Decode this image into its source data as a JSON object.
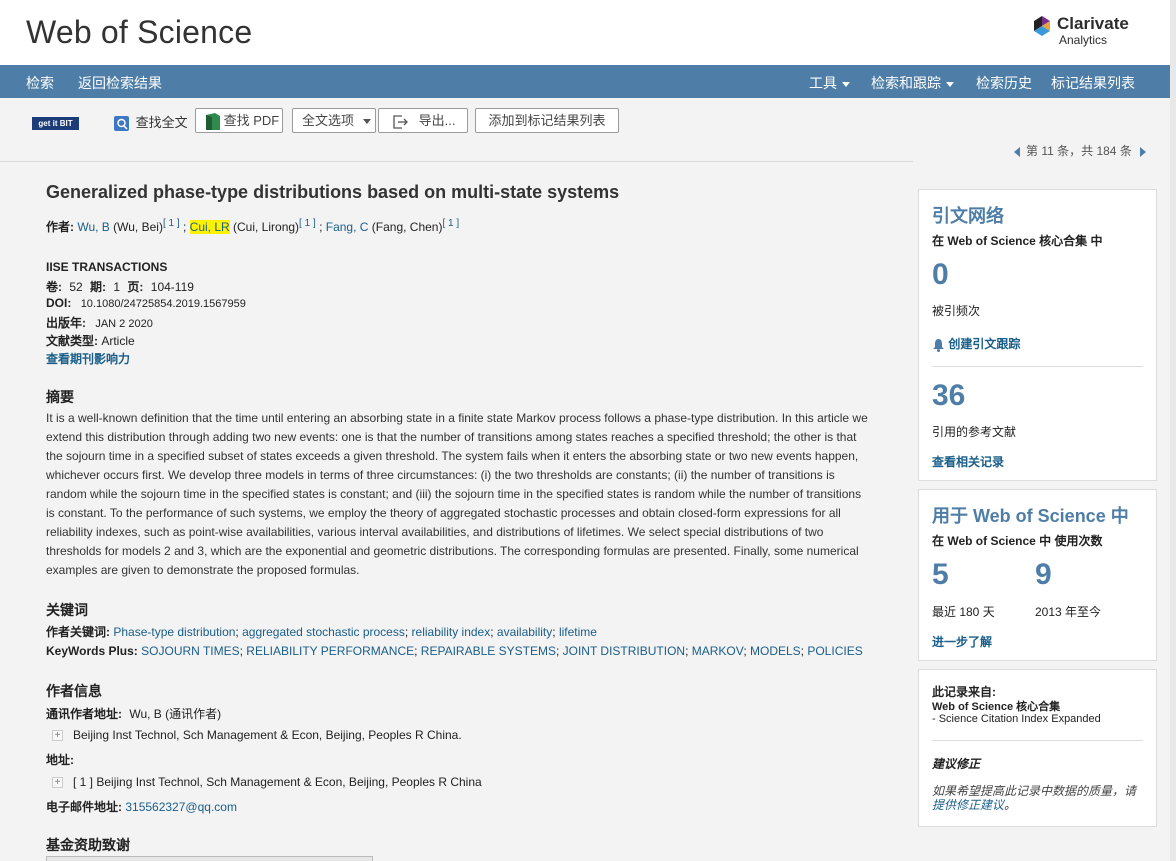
{
  "header": {
    "brand": "Web of Science",
    "vendor_line1": "Clarivate",
    "vendor_line2": "Analytics"
  },
  "nav": {
    "search": "检索",
    "back": "返回检索结果",
    "tools": "工具",
    "search_track": "检索和跟踪",
    "history": "检索历史",
    "marked_list": "标记结果列表"
  },
  "toolbar": {
    "getit": "get it BIT",
    "fulltext": "查找全文",
    "find_pdf": "查找 PDF",
    "fulltext_options": "全文选项",
    "export": "导出...",
    "add_marked": "添加到标记结果列表"
  },
  "pager": {
    "text": "第 11 条，共 184 条"
  },
  "record": {
    "title": "Generalized phase-type distributions based on multi-state systems",
    "authors_label": "作者:",
    "author1": "Wu, B",
    "author1_full": "(Wu, Bei)",
    "author2": "Cui, LR",
    "author2_full": "(Cui, Lirong)",
    "author3": "Fang, C",
    "author3_full": "(Fang, Chen)",
    "affil_ref": "[ 1 ]",
    "journal": "IISE TRANSACTIONS",
    "volume_label": "卷:",
    "volume": "52",
    "issue_label": "期:",
    "issue": "1",
    "pages_label": "页:",
    "pages": "104-119",
    "doi_label": "DOI:",
    "doi": "10.1080/24725854.2019.1567959",
    "pubdate_label": "出版年:",
    "pubdate": "JAN 2 2020",
    "doctype_label": "文献类型:",
    "doctype": "Article",
    "journal_impact": "查看期刊影响力",
    "abstract_heading": "摘要",
    "abstract": "It is a well-known definition that the time until entering an absorbing state in a finite state Markov process follows a phase-type distribution. In this article we extend this distribution through adding two new events: one is that the number of transitions among states reaches a specified threshold; the other is that the sojourn time in a specified subset of states exceeds a given threshold. The system fails when it enters the absorbing state or two new events happen, whichever occurs first. We develop three models in terms of three circumstances: (i) the two thresholds are constants; (ii) the number of transitions is random while the sojourn time in the specified states is constant; and (iii) the sojourn time in the specified states is random while the number of transitions is constant. To the performance of such systems, we employ the theory of aggregated stochastic processes and obtain closed-form expressions for all reliability indexes, such as point-wise availabilities, various interval availabilities, and distributions of lifetimes. We select special distributions of two thresholds for models 2 and 3, which are the exponential and geometric distributions. The corresponding formulas are presented. Finally, some numerical examples are given to demonstrate the proposed formulas.",
    "keywords_heading": "关键词",
    "author_kw_label": "作者关键词:",
    "author_keywords": [
      "Phase-type distribution",
      "aggregated stochastic process",
      "reliability index",
      "availability",
      "lifetime"
    ],
    "kwplus_label": "KeyWords Plus:",
    "keywords_plus": [
      "SOJOURN TIMES",
      "RELIABILITY PERFORMANCE",
      "REPAIRABLE SYSTEMS",
      "JOINT DISTRIBUTION",
      "MARKOV",
      "MODELS",
      "POLICIES"
    ],
    "author_info_heading": "作者信息",
    "corr_label": "通讯作者地址:",
    "corr_author": "Wu, B (通讯作者)",
    "corr_address": "Beijing Inst Technol, Sch Management & Econ, Beijing, Peoples R China.",
    "address_label": "地址:",
    "address": "[ 1 ] Beijing Inst Technol, Sch Management & Econ, Beijing, Peoples R China",
    "email_label": "电子邮件地址:",
    "email": "315562327@qq.com",
    "funding_heading": "基金资助致谢"
  },
  "citation_network": {
    "heading": "引文网络",
    "core_label": "在 Web of Science 核心合集 中",
    "times_cited": "0",
    "times_cited_label": "被引频次",
    "create_alert": "创建引文跟踪",
    "refs_count": "36",
    "refs_label": "引用的参考文献",
    "related": "查看相关记录"
  },
  "usage": {
    "heading": "用于 Web of Science 中",
    "sub": "在 Web of Science 中 使用次数",
    "last180": "5",
    "last180_label": "最近 180 天",
    "since2013": "9",
    "since2013_label": "2013 年至今",
    "learn_more": "进一步了解"
  },
  "source": {
    "label": "此记录来自:",
    "db": "Web of Science 核心合集",
    "index": "- Science Citation Index Expanded",
    "suggest_heading": "建议修正",
    "suggest_text": "如果希望提高此记录中数据的质量，请",
    "suggest_link": "提供修正建议",
    "suggest_end": "。"
  },
  "colors": {
    "nav": "#4e7ea7",
    "link": "#1a5e8a",
    "highlight": "#fff200"
  }
}
